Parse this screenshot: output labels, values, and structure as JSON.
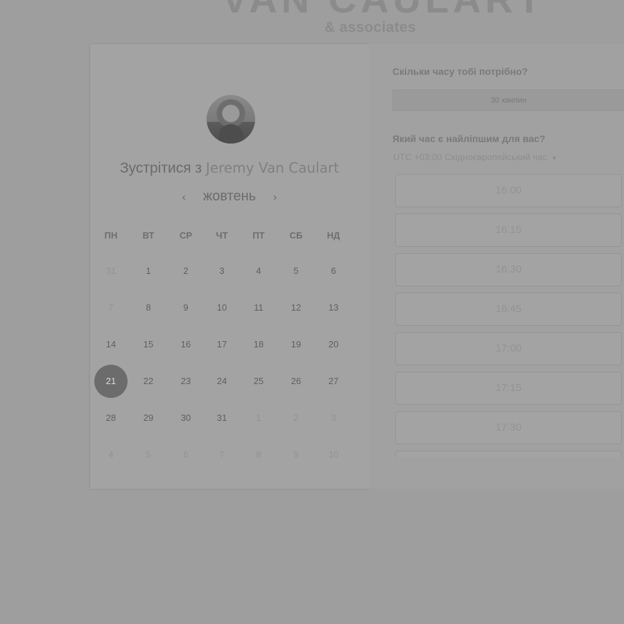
{
  "brand": {
    "title": "VAN CAULART",
    "subtitle": "& associates"
  },
  "profile": {
    "meet_prefix": "Зустрітися з",
    "name": "Jeremy Van Caulart"
  },
  "calendar": {
    "month": "жовтень",
    "prev_icon": "chevron-left-icon",
    "next_icon": "chevron-right-icon",
    "weekdays": [
      "ПН",
      "ВТ",
      "СР",
      "ЧТ",
      "ПТ",
      "СБ",
      "НД"
    ],
    "weeks": [
      [
        "31",
        "1",
        "2",
        "3",
        "4",
        "5",
        "6"
      ],
      [
        "7",
        "8",
        "9",
        "10",
        "11",
        "12",
        "13"
      ],
      [
        "14",
        "15",
        "16",
        "17",
        "18",
        "19",
        "20"
      ],
      [
        "21",
        "22",
        "23",
        "24",
        "25",
        "26",
        "27"
      ],
      [
        "28",
        "29",
        "30",
        "31",
        "1",
        "2",
        "3"
      ],
      [
        "4",
        "5",
        "6",
        "7",
        "8",
        "9",
        "10"
      ]
    ],
    "selected_day": "21"
  },
  "booking": {
    "duration_question": "Скільки часу тобі потрібно?",
    "duration_value": "30 хвилин",
    "time_question": "Який час є найліпшим для вас?",
    "timezone": "UTC +03:00 Східноєвропейський час",
    "slots": [
      "16:00",
      "16:15",
      "16:30",
      "16:45",
      "17:00",
      "17:15",
      "17:30"
    ]
  }
}
